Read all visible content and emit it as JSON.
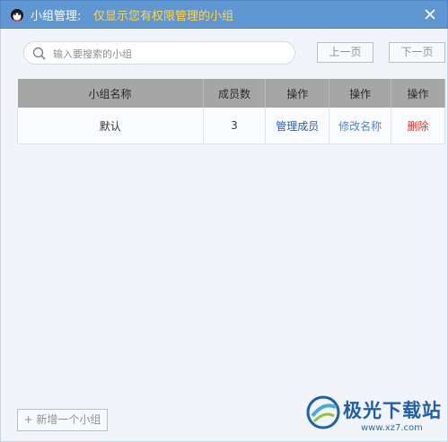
{
  "window": {
    "title": "小组管理:",
    "subtitle": "仅显示您有权限管理的小组",
    "close_icon": "close-icon"
  },
  "search": {
    "placeholder": "输入要搜索的小组",
    "value": ""
  },
  "pagination": {
    "prev_label": "上一页",
    "next_label": "下一页"
  },
  "table": {
    "headers": [
      "小组名称",
      "成员数",
      "操作",
      "操作",
      "操作"
    ],
    "rows": [
      {
        "name": "默认",
        "members": "3",
        "manage_label": "管理成员",
        "rename_label": "修改名称",
        "delete_label": "删除"
      }
    ]
  },
  "footer": {
    "add_group_label": "+ 新增一个小组"
  },
  "watermark": {
    "brand": "极光下载站",
    "url": "www.xz7.com"
  },
  "colors": {
    "titlebar": "#5f97d2",
    "subtitle": "#ffd64a",
    "manage_link": "#2a5db0",
    "rename_link": "#4a86d8",
    "delete_link": "#d9342b"
  }
}
